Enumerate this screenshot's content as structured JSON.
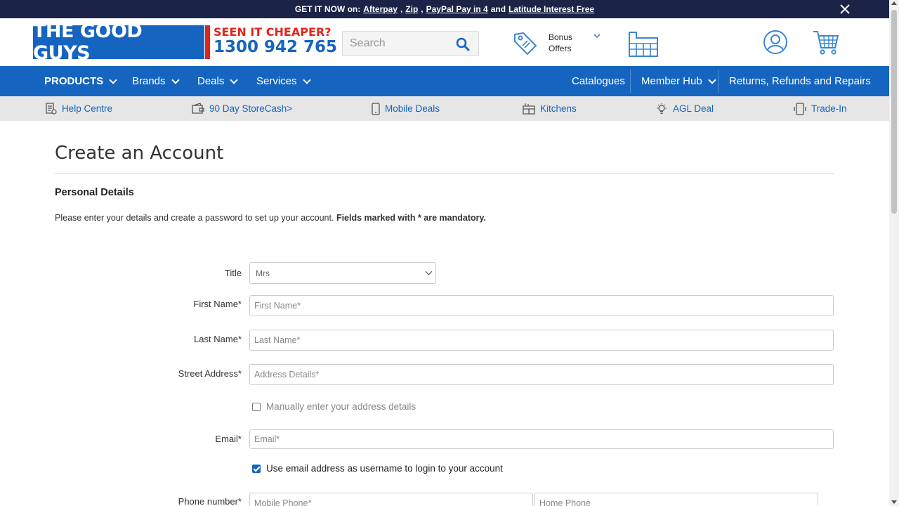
{
  "promo": {
    "prefix": "GET IT NOW on:",
    "links": [
      "Afterpay",
      "Zip",
      "PayPal Pay in 4"
    ],
    "and": "and",
    "last_link": "Latitude Interest Free",
    "comma": ","
  },
  "header": {
    "logo_text": "THE GOOD GUYS",
    "cheaper_line1": "SEEN IT CHEAPER?",
    "cheaper_line2": "1300 942 765",
    "search_placeholder": "Search",
    "bonus_line1": "Bonus",
    "bonus_line2": "Offers"
  },
  "nav": {
    "left": [
      {
        "label": "PRODUCTS"
      },
      {
        "label": "Brands"
      },
      {
        "label": "Deals"
      },
      {
        "label": "Services"
      }
    ],
    "right": [
      {
        "label": "Catalogues"
      },
      {
        "label": "Member Hub"
      },
      {
        "label": "Returns, Refunds and Repairs"
      }
    ]
  },
  "subnav": [
    {
      "label": "Help Centre",
      "icon": "help-doc-icon"
    },
    {
      "label": "90 Day StoreCash>",
      "icon": "wallet-icon"
    },
    {
      "label": "Mobile Deals",
      "icon": "mobile-icon"
    },
    {
      "label": "Kitchens",
      "icon": "kitchen-icon"
    },
    {
      "label": "AGL Deal",
      "icon": "lightbulb-icon"
    },
    {
      "label": "Trade-In",
      "icon": "trade-in-icon"
    }
  ],
  "page": {
    "title": "Create an Account",
    "section_title": "Personal Details",
    "intro_text": "Please enter your details and create a password to set up your account.",
    "intro_bold": "Fields marked with * are mandatory."
  },
  "form": {
    "title_label": "Title",
    "title_value": "Mrs",
    "first_name_label": "First Name*",
    "first_name_placeholder": "First Name*",
    "last_name_label": "Last Name*",
    "last_name_placeholder": "Last Name*",
    "street_label": "Street Address*",
    "street_placeholder": "Address Details*",
    "manual_address_label": "Manually enter your address details",
    "manual_address_checked": false,
    "email_label": "Email*",
    "email_placeholder": "Email*",
    "use_email_label": "Use email address as username to login to your account",
    "use_email_checked": true,
    "phone_label": "Phone number*",
    "mobile_placeholder": "Mobile Phone*",
    "home_placeholder": "Home Phone"
  },
  "colors": {
    "brand_blue": "#1565c0",
    "brand_red": "#e2231a",
    "promo_bg": "#1b2346",
    "subnav_bg": "#e6e6e6"
  }
}
